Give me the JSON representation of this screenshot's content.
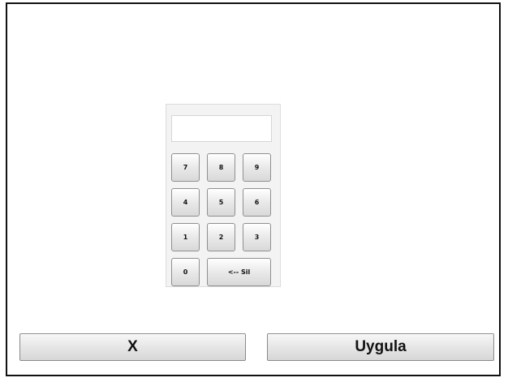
{
  "keypad": {
    "display_value": "",
    "keys": {
      "k7": "7",
      "k8": "8",
      "k9": "9",
      "k4": "4",
      "k5": "5",
      "k6": "6",
      "k1": "1",
      "k2": "2",
      "k3": "3",
      "k0": "0",
      "backspace": "<-- Sil"
    }
  },
  "actions": {
    "cancel_label": "X",
    "apply_label": "Uygula"
  }
}
